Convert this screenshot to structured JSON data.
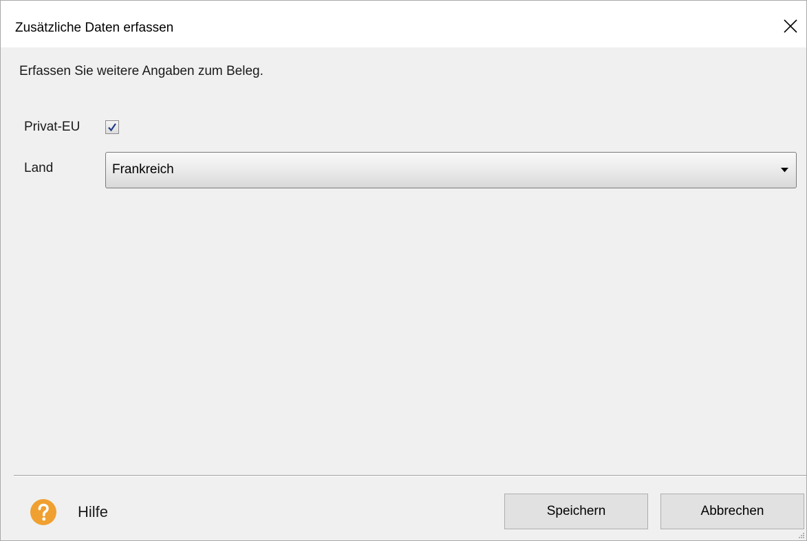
{
  "dialog": {
    "title": "Zusätzliche Daten erfassen",
    "instruction": "Erfassen Sie weitere Angaben zum Beleg."
  },
  "form": {
    "privat_eu": {
      "label": "Privat-EU",
      "checked": true
    },
    "land": {
      "label": "Land",
      "value": "Frankreich"
    }
  },
  "footer": {
    "help_label": "Hilfe",
    "save_label": "Speichern",
    "cancel_label": "Abbrechen"
  },
  "icons": {
    "close": "close-icon",
    "help": "question-mark-icon",
    "check": "checkmark-icon",
    "dropdown": "chevron-down-icon"
  },
  "colors": {
    "help_icon": "#f0a030",
    "checkmark": "#1e3a8a"
  }
}
